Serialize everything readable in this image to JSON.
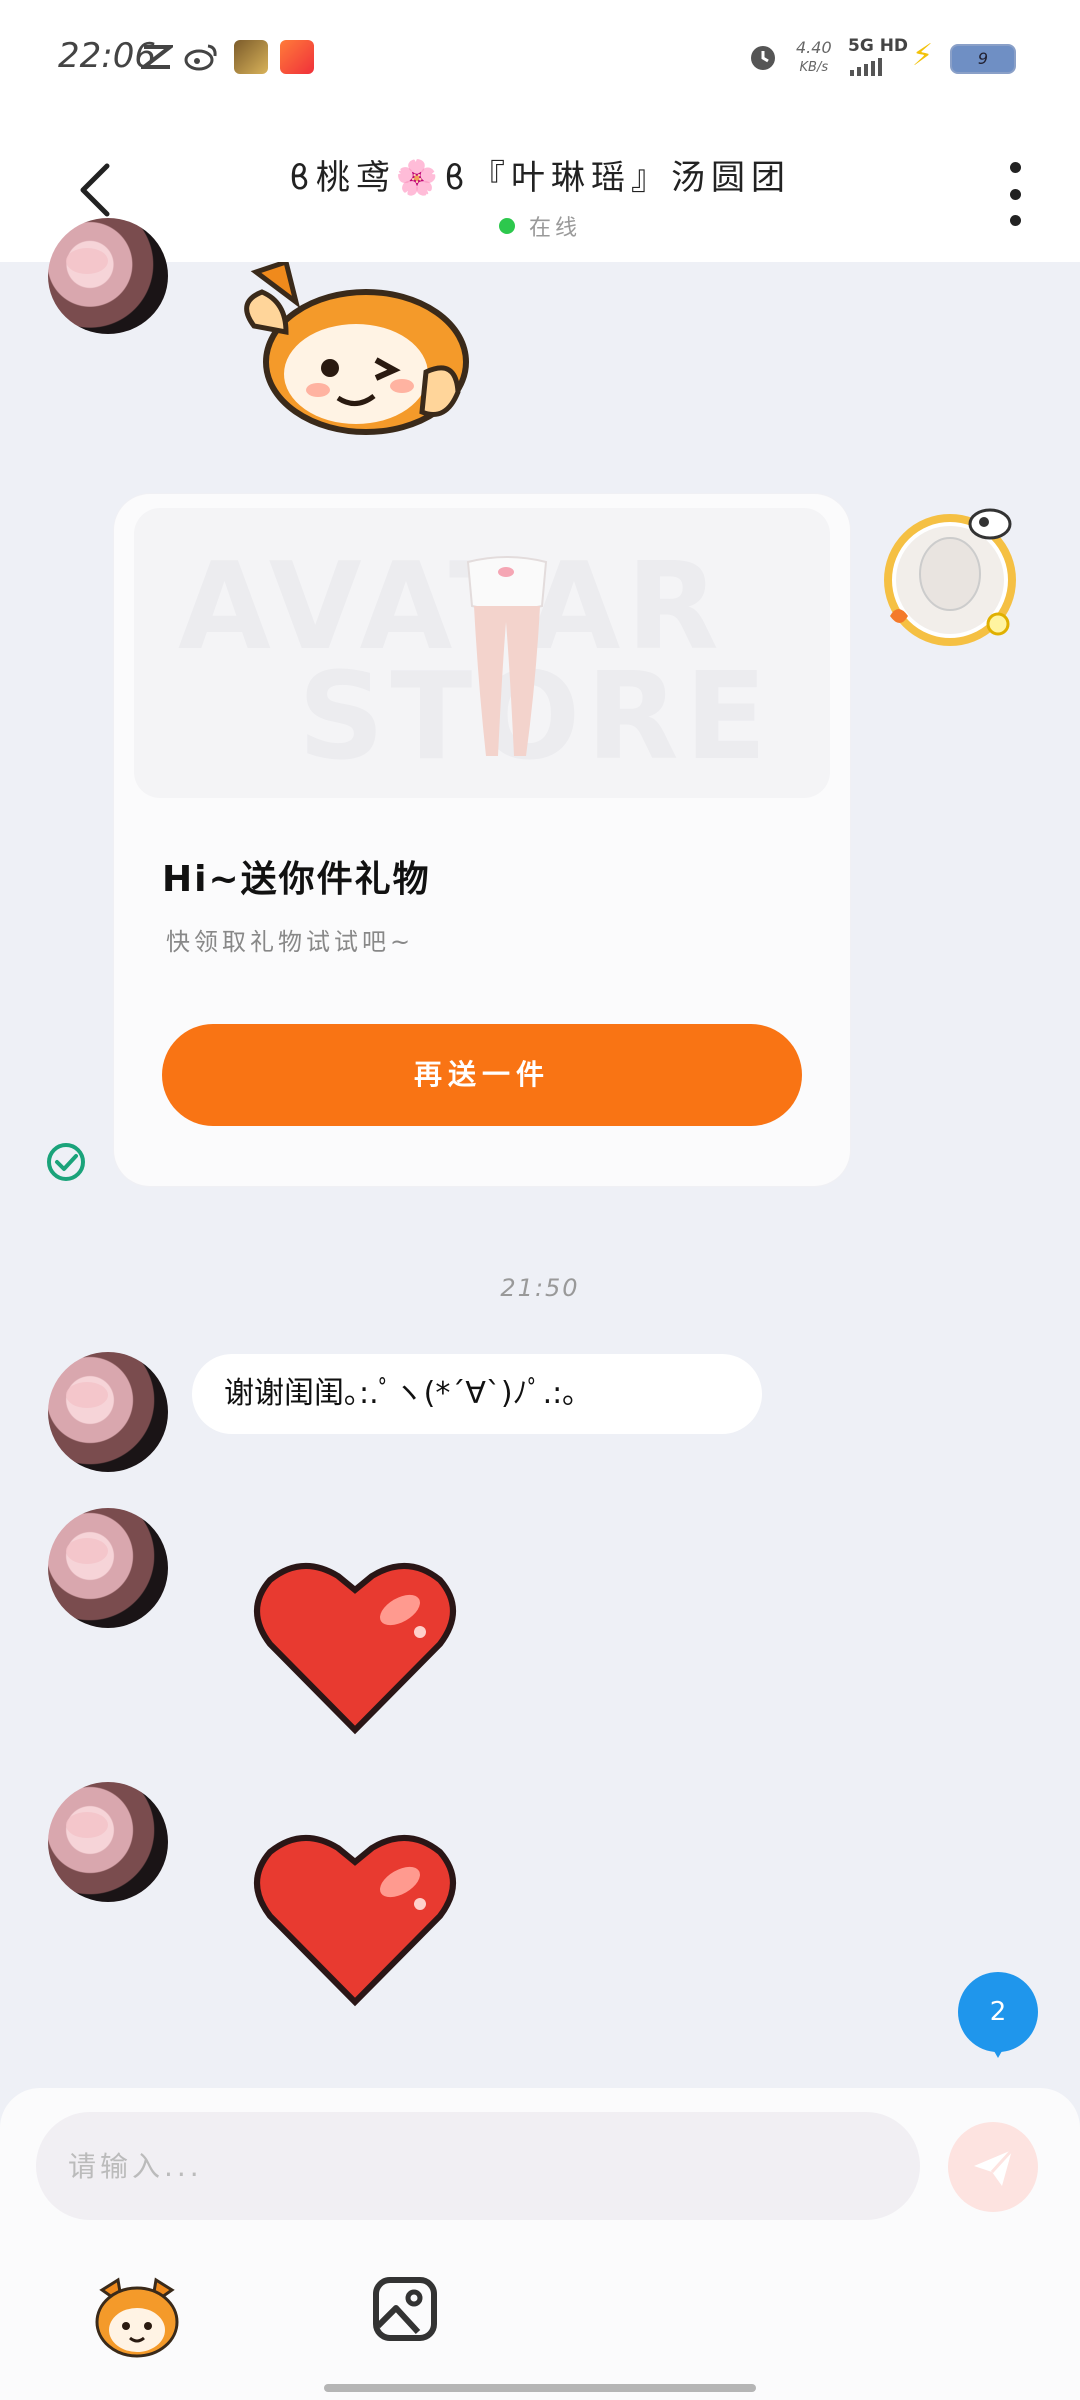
{
  "status_bar": {
    "time": "22:06",
    "net_speed_value": "4.40",
    "net_speed_unit": "KB/s",
    "network": "5G HD",
    "battery": "9"
  },
  "header": {
    "title": "ϐ桃鸢🌸ϐ『叶琳瑶』汤圆团",
    "status": "在线"
  },
  "gift_card": {
    "watermark_line1": "AVATAR",
    "watermark_line2": "STORE",
    "title": "Hi~送你件礼物",
    "subtitle": "快领取礼物试试吧~",
    "button_label": "再送一件"
  },
  "chat": {
    "timestamp": "21:50",
    "message_text": "谢谢闺闺｡:.ﾟヽ(*´∀`)ﾉﾟ.:｡"
  },
  "unread_count": "2",
  "input": {
    "placeholder": "请输入..."
  },
  "colors": {
    "accent_orange": "#f97414",
    "online_green": "#2dc84d",
    "badge_blue": "#1f96ec",
    "background": "#eef0f6"
  },
  "icons": [
    "back-arrow-icon",
    "more-vertical-icon",
    "check-circle-icon",
    "send-icon",
    "image-icon",
    "mascot-icon",
    "heart-sticker",
    "alarm-icon"
  ]
}
